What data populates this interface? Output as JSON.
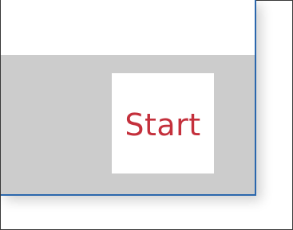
{
  "dialog": {
    "start_button": {
      "label": "Start"
    }
  },
  "colors": {
    "accent_text": "#c4303c",
    "dialog_border": "#2b67ad",
    "footer_background": "#cccccc"
  }
}
